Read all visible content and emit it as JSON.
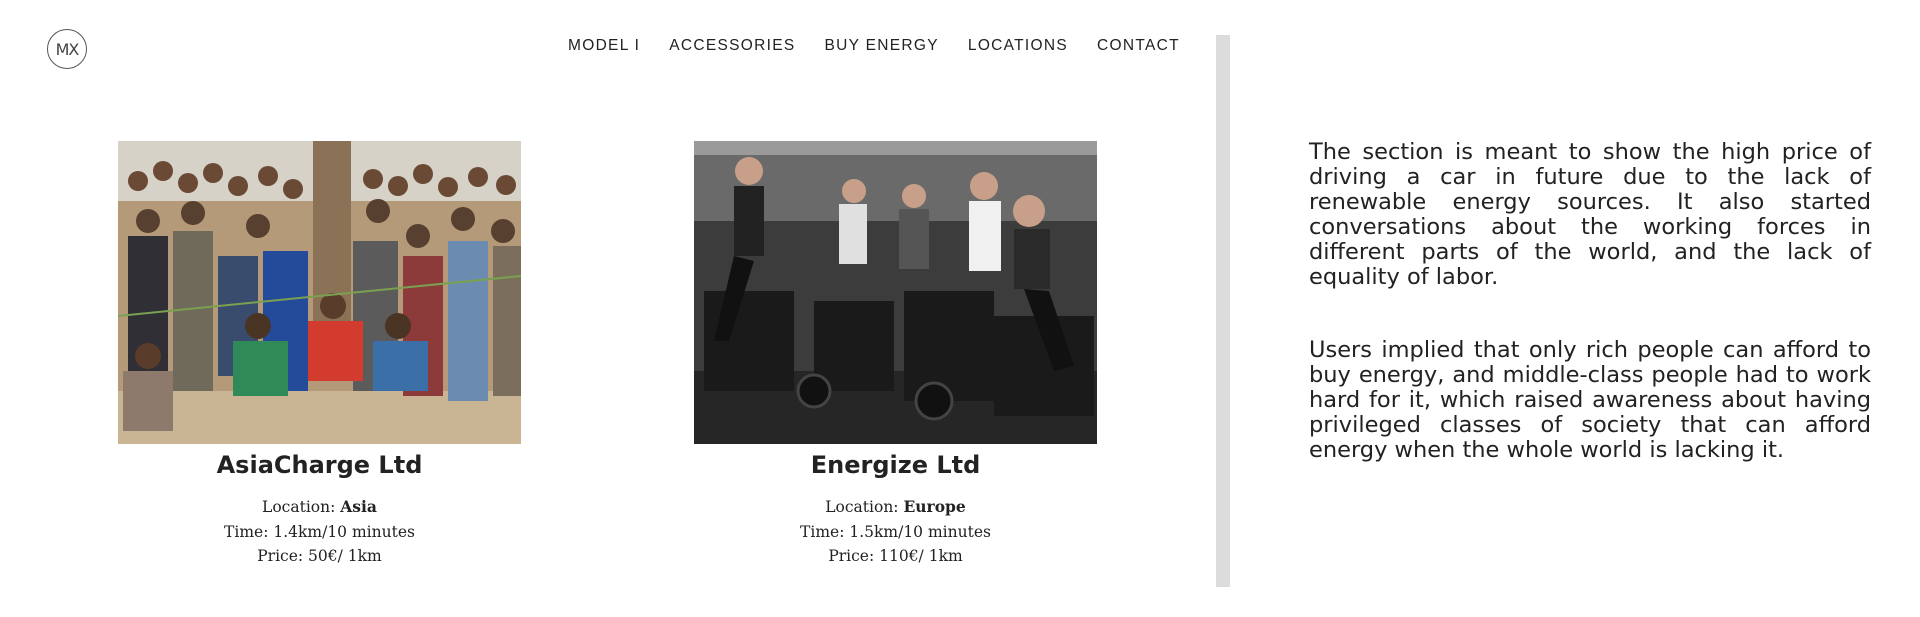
{
  "logo": {
    "text": "MX"
  },
  "nav": {
    "items": [
      {
        "label": "MODEL I"
      },
      {
        "label": "ACCESSORIES"
      },
      {
        "label": "BUY ENERGY"
      },
      {
        "label": "LOCATIONS"
      },
      {
        "label": "CONTACT"
      }
    ]
  },
  "cards": [
    {
      "title": "AsiaCharge Ltd",
      "location_label": "Location: ",
      "location_value": "Asia",
      "time": "Time: 1.4km/10 minutes",
      "price": "Price: 50€/ 1km"
    },
    {
      "title": "Energize Ltd",
      "location_label": "Location: ",
      "location_value": "Europe",
      "time": "Time: 1.5km/10 minutes",
      "price": "Price: 110€/ 1km"
    }
  ],
  "side": {
    "p1": "The section is meant to show the high price of driving a car in future due to the lack of renewable energy sources. It also started conversations about the working forces in different parts of the world, and the lack of equality of labor.",
    "p2": "Users implied that only rich people can afford to buy energy, and middle-class people had to work hard for it, which raised awareness about having privileged classes of society that can afford energy when the whole world is lacking it."
  },
  "colors": {
    "text": "#222222",
    "divider": "#dcdcdc",
    "background": "#ffffff"
  }
}
